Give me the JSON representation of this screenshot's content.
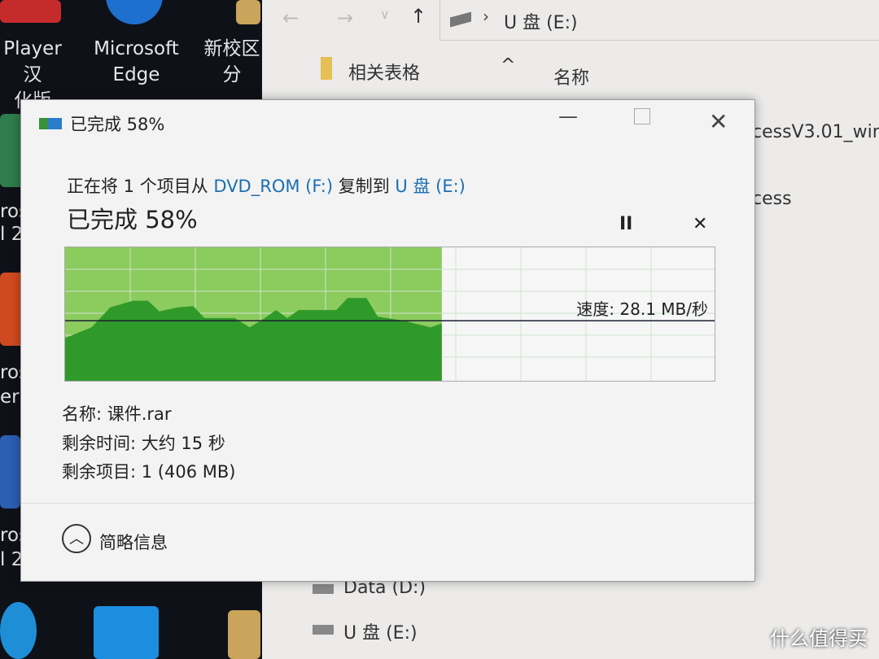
{
  "desktop": {
    "icons": [
      {
        "label": "Player汉\n化版"
      },
      {
        "label": "Microsoft\nEdge"
      },
      {
        "label": "新校区\n分"
      }
    ],
    "partial_labels": [
      "ros",
      "l 2",
      "ros",
      "erP",
      "ros",
      "l 2"
    ]
  },
  "explorer": {
    "address": "U 盘 (E:)",
    "nav_folder": "相关表格",
    "column_header": "名称",
    "files": [
      "cessV3.01_win",
      "cess"
    ],
    "drives": [
      "Data (D:)",
      "U 盘 (E:)"
    ]
  },
  "dialog": {
    "title": "已完成 58%",
    "copy_prefix": "正在将 1 个项目从 ",
    "source": "DVD_ROM (F:)",
    "copy_mid": " 复制到 ",
    "dest": "U 盘 (E:)",
    "percent_text": "已完成 58%",
    "progress_percent": 58,
    "speed": "速度: 28.1 MB/秒",
    "name": "名称: 课件.rar",
    "time_left": "剩余时间: 大约 15 秒",
    "items_left": "剩余项目: 1 (406 MB)",
    "less_details": "简略信息",
    "colors": {
      "fill_light": "#8ccb5e",
      "fill_dark": "#2f9a2a",
      "link": "#1a6fb3"
    }
  },
  "watermark": "什么值得买"
}
